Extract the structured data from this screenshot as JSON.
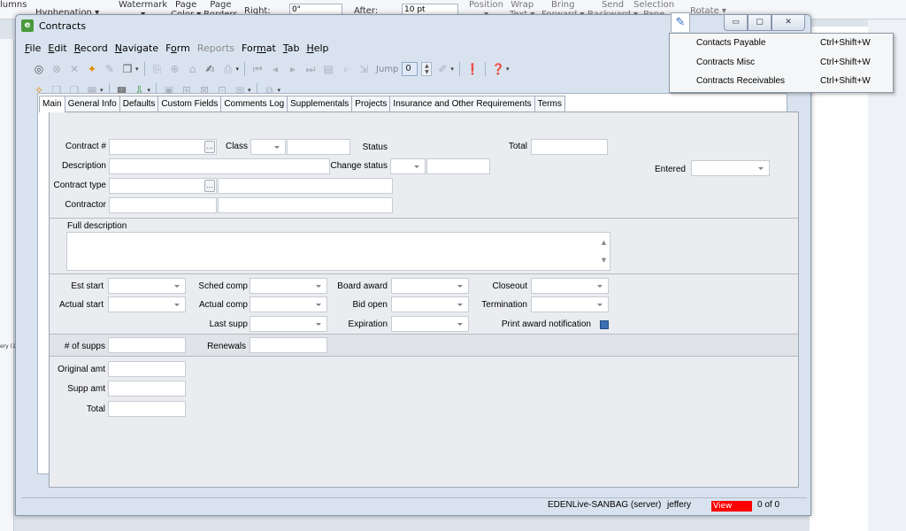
{
  "background": {
    "ribbon": [
      {
        "text": "lumns",
        "sub": ""
      },
      {
        "text": "Hyphenation ▾",
        "sub": ""
      },
      {
        "text": "Watermark",
        "sub": "▾"
      },
      {
        "text": "Page",
        "sub": "Color ▾"
      },
      {
        "text": "Page",
        "sub": "Borders"
      },
      {
        "text": "Right:",
        "sub": ""
      },
      {
        "text": "After:",
        "sub": ""
      },
      {
        "text": "Position",
        "sub": "▾"
      },
      {
        "text": "Wrap",
        "sub": "Text ▾"
      },
      {
        "text": "Bring",
        "sub": "Forward ▾"
      },
      {
        "text": "Send",
        "sub": "Backward ▾"
      },
      {
        "text": "Selection",
        "sub": "Pane"
      },
      {
        "text": "Rotate ▾",
        "sub": ""
      }
    ],
    "right_value": "0\"",
    "after_value": "10 pt",
    "left_note": "ery (1 e"
  },
  "window": {
    "title": "Contracts",
    "app_icon": "e",
    "controls": {
      "minimize": "▭",
      "maximize": "▢",
      "close": "✕"
    }
  },
  "menu": [
    {
      "label": "File",
      "underline": "F",
      "enabled": true
    },
    {
      "label": "Edit",
      "underline": "E",
      "enabled": true
    },
    {
      "label": "Record",
      "underline": "R",
      "enabled": true
    },
    {
      "label": "Navigate",
      "underline": "N",
      "enabled": true
    },
    {
      "label": "Form",
      "underline": "o",
      "enabled": true
    },
    {
      "label": "Reports",
      "underline": "",
      "enabled": false
    },
    {
      "label": "Format",
      "underline": "m",
      "enabled": true
    },
    {
      "label": "Tab",
      "underline": "T",
      "enabled": true
    },
    {
      "label": "Help",
      "underline": "H",
      "enabled": true
    }
  ],
  "toolbar": {
    "jump_label": "Jump",
    "jump_value": "0"
  },
  "tabs": [
    {
      "label": "Main",
      "active": true
    },
    {
      "label": "General Info",
      "active": false
    },
    {
      "label": "Defaults",
      "active": false
    },
    {
      "label": "Custom Fields",
      "active": false
    },
    {
      "label": "Comments Log",
      "active": false
    },
    {
      "label": "Supplementals",
      "active": false
    },
    {
      "label": "Projects",
      "active": false
    },
    {
      "label": "Insurance and Other Requirements",
      "active": false
    },
    {
      "label": "Terms",
      "active": false
    }
  ],
  "form": {
    "contract_no": "Contract #",
    "class": "Class",
    "status": "Status",
    "total": "Total",
    "description": "Description",
    "change_status": "Change status",
    "entered": "Entered",
    "contract_type": "Contract type",
    "contractor": "Contractor",
    "full_description": "Full description",
    "est_start": "Est start",
    "sched_comp": "Sched comp",
    "board_award": "Board award",
    "closeout": "Closeout",
    "actual_start": "Actual start",
    "actual_comp": "Actual comp",
    "bid_open": "Bid open",
    "termination": "Termination",
    "last_supp": "Last supp",
    "expiration": "Expiration",
    "print_award": "Print award notification",
    "num_supps": "# of supps",
    "renewals": "Renewals",
    "original_amt": "Original amt",
    "supp_amt": "Supp amt",
    "total2": "Total"
  },
  "status_bar": {
    "server": "EDENLive-SANBAG (server)",
    "user": "jeffery",
    "view": "View",
    "records": "0 of 0"
  },
  "dropdown": {
    "items": [
      {
        "label": "Contacts Payable",
        "shortcut": "Ctrl+Shift+W"
      },
      {
        "label": "Contracts Misc",
        "shortcut": "Ctrl+Shift+W"
      },
      {
        "label": "Contracts Receivables",
        "shortcut": "Ctrl+Shift+W"
      }
    ]
  },
  "colors": {
    "view_badge": "#ff0000",
    "app_icon": "#4a9a3b",
    "accent": "#2f6fc9"
  }
}
